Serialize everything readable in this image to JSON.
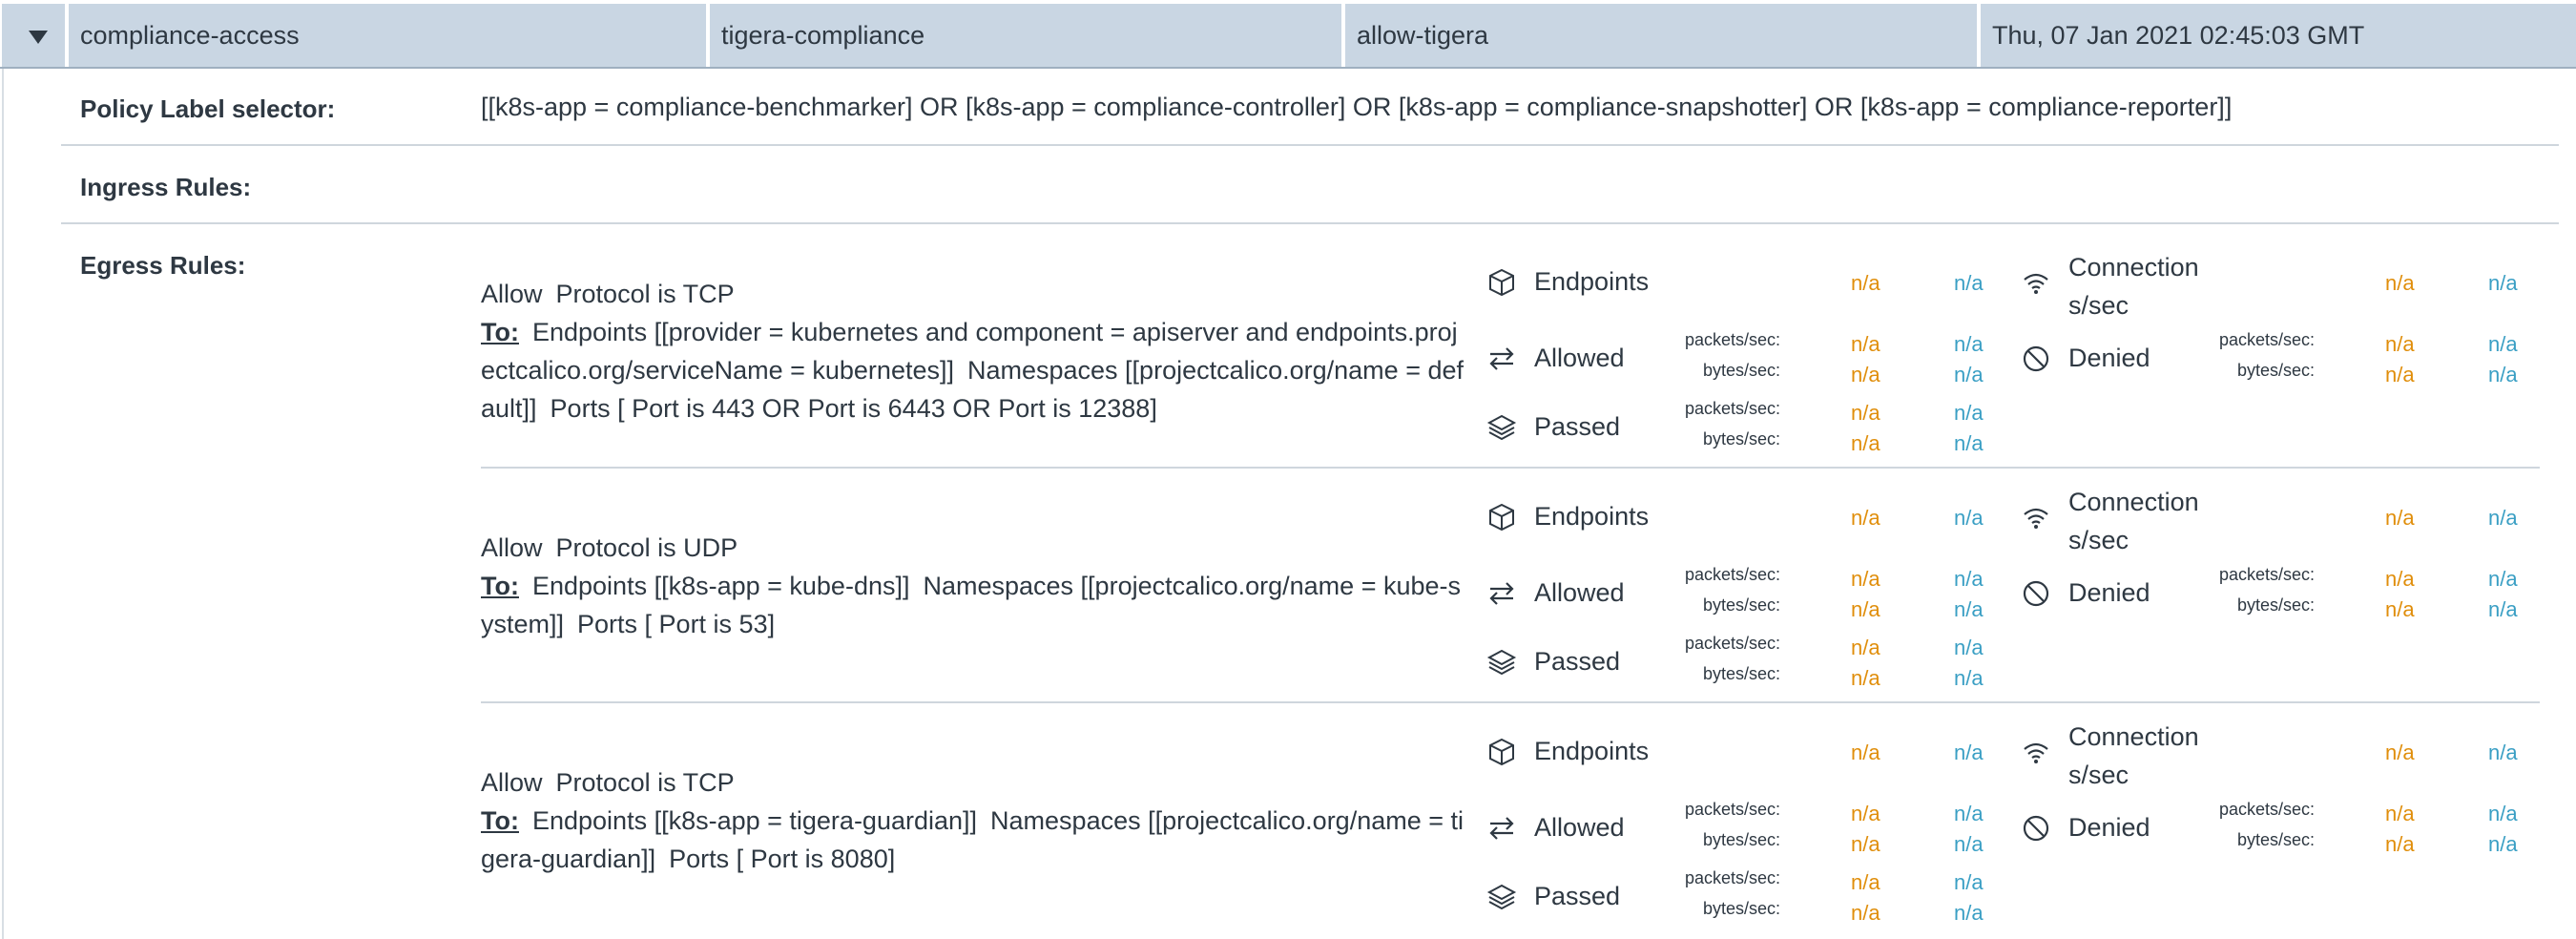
{
  "header": {
    "name": "compliance-access",
    "namespace": "tigera-compliance",
    "tier": "allow-tigera",
    "timestamp": "Thu, 07 Jan 2021 02:45:03 GMT"
  },
  "details": {
    "selector_label": "Policy Label selector:",
    "selector_value": "[[k8s-app = compliance-benchmarker] OR [k8s-app = compliance-controller] OR [k8s-app = compliance-snapshotter] OR [k8s-app = compliance-reporter]]",
    "ingress_label": "Ingress Rules:",
    "egress_label": "Egress Rules:"
  },
  "metric_labels": {
    "endpoints": "Endpoints",
    "allowed": "Allowed",
    "passed": "Passed",
    "connections": "Connection s/sec",
    "denied": "Denied",
    "packets": "packets/sec:",
    "bytes": "bytes/sec:",
    "na": "n/a"
  },
  "rules": [
    {
      "action": "Allow",
      "protocol": "Protocol is TCP",
      "to_label": "To:",
      "endpoints": "Endpoints [[provider = kubernetes and component = apiserver and endpoints.projectcalico.org/serviceName = kubernetes]]",
      "namespaces": "Namespaces [[projectcalico.org/name = default]]",
      "ports": "Ports [ Port is 443 OR Port is 6443 OR Port is 12388]"
    },
    {
      "action": "Allow",
      "protocol": "Protocol is UDP",
      "to_label": "To:",
      "endpoints": "Endpoints [[k8s-app = kube-dns]]",
      "namespaces": "Namespaces [[projectcalico.org/name = kube-system]]",
      "ports": "Ports [ Port is 53]"
    },
    {
      "action": "Allow",
      "protocol": "Protocol is TCP",
      "to_label": "To:",
      "endpoints": "Endpoints [[k8s-app = tigera-guardian]]",
      "namespaces": "Namespaces [[projectcalico.org/name = tigera-guardian]]",
      "ports": "Ports [ Port is 8080]"
    }
  ],
  "colors": {
    "header_bg": "#c9d6e3",
    "na_orange": "#e08e0b",
    "na_blue": "#3a9fc4"
  },
  "icons": [
    "caret-down-icon",
    "cube-icon",
    "arrows-exchange-icon",
    "layers-icon",
    "wifi-icon",
    "denied-icon"
  ]
}
